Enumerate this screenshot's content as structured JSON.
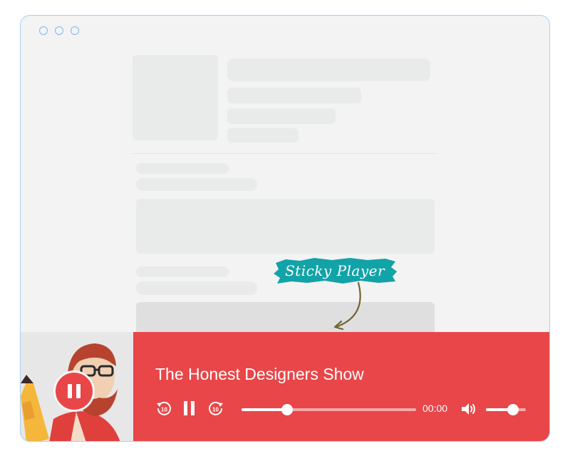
{
  "annotation": {
    "label": "Sticky Player",
    "color": "#12a3a8"
  },
  "player": {
    "title": "The Honest Designers Show",
    "time": "00:00",
    "progress": 0.26,
    "volume": 0.68,
    "accent": "#e84649",
    "thumbnail_icon": "pause-icon",
    "rewind_label": "10",
    "forward_label": "10"
  }
}
